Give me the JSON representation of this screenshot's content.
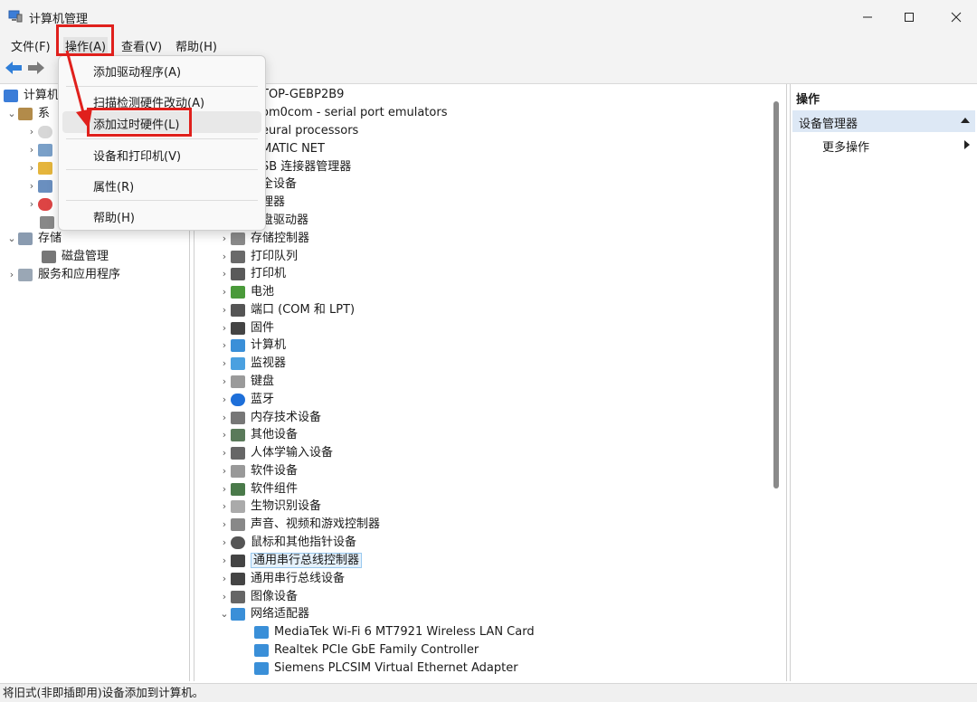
{
  "window": {
    "title": "计算机管理"
  },
  "menubar": {
    "file": "文件(F)",
    "action": "操作(A)",
    "view": "查看(V)",
    "help": "帮助(H)"
  },
  "dropdown": {
    "add_driver": "添加驱动程序(A)",
    "scan": "扫描检测硬件改动(A)",
    "add_legacy": "添加过时硬件(L)",
    "devices_printers": "设备和打印机(V)",
    "properties": "属性(R)",
    "help": "帮助(H)"
  },
  "left_tree": {
    "root": "计算机",
    "system": "系",
    "storage": "存储",
    "disk_mgmt": "磁盘管理",
    "services": "服务和应用程序"
  },
  "device_tree": {
    "computer_name": "TOP-GEBP2B9",
    "partial_items": [
      "om0com - serial port emulators",
      "eural processors",
      "MATIC NET",
      "SB 连接器管理器",
      "全设备",
      "理器",
      "盘驱动器"
    ],
    "items": [
      "存储控制器",
      "打印队列",
      "打印机",
      "电池",
      "端口 (COM 和 LPT)",
      "固件",
      "计算机",
      "监视器",
      "键盘",
      "蓝牙",
      "内存技术设备",
      "其他设备",
      "人体学输入设备",
      "软件设备",
      "软件组件",
      "生物识别设备",
      "声音、视频和游戏控制器",
      "鼠标和其他指针设备",
      "通用串行总线控制器",
      "通用串行总线设备",
      "图像设备",
      "网络适配器"
    ],
    "network_children": [
      "MediaTek Wi-Fi 6 MT7921 Wireless LAN Card",
      "Realtek PCIe GbE Family Controller",
      "Siemens PLCSIM Virtual Ethernet Adapter"
    ]
  },
  "actions_pane": {
    "header": "操作",
    "section": "设备管理器",
    "more": "更多操作"
  },
  "status": {
    "text": "将旧式(非即插即用)设备添加到计算机。"
  },
  "colors": {
    "accent": "#0067c0",
    "highlight": "#e0201c",
    "selected_bg": "#e5f1fb",
    "section_bg": "#dde8f5"
  }
}
